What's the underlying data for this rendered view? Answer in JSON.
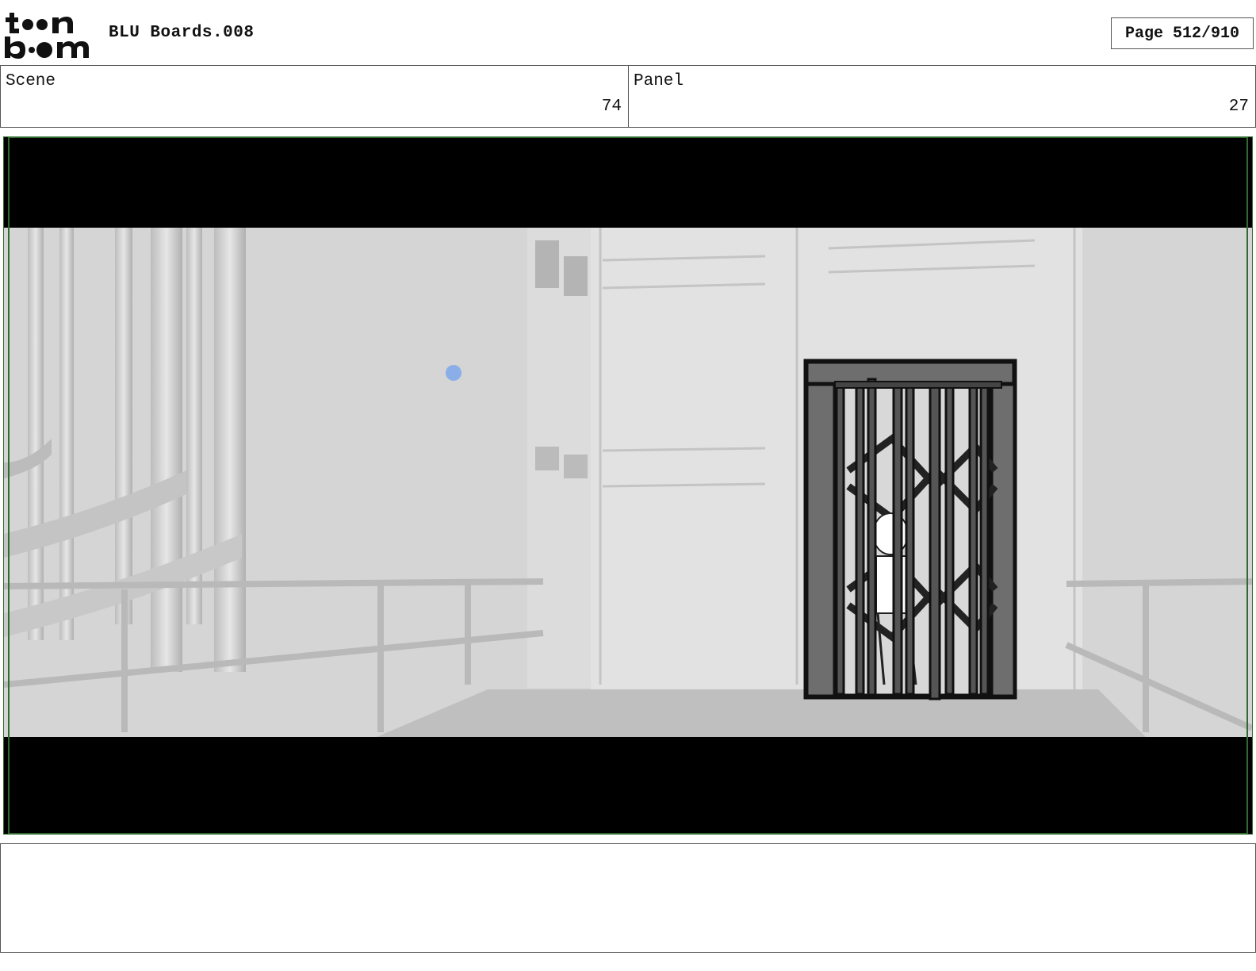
{
  "header": {
    "logo_alt": "toon boom",
    "project_title": "BLU Boards.008",
    "page_label": "Page 512/910"
  },
  "info": {
    "scene_label": "Scene",
    "scene_value": "74",
    "panel_label": "Panel",
    "panel_value": "27"
  },
  "frame": {
    "letterbox_color": "#000000",
    "safe_border_color": "#2e6b2e",
    "background_gray": "#d4d4d4",
    "marker_color": "#8aaee8"
  },
  "notes": {
    "text": ""
  }
}
